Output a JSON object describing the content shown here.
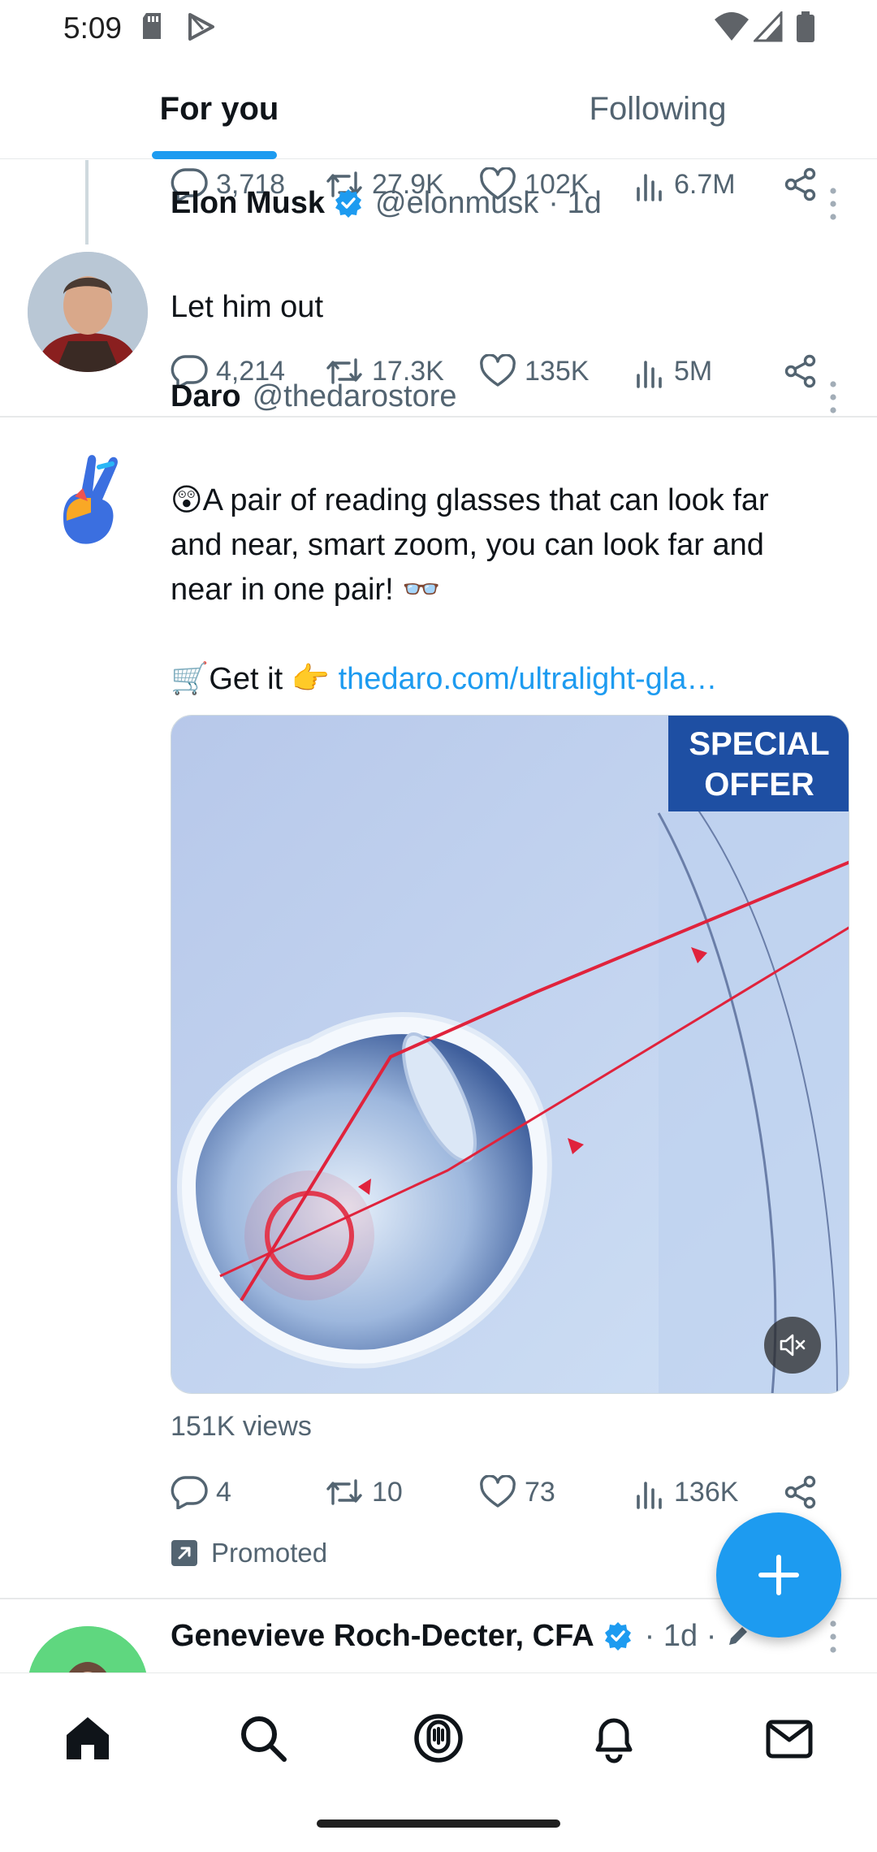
{
  "status_bar": {
    "time": "5:09"
  },
  "tabs": [
    {
      "label": "For you",
      "active": true
    },
    {
      "label": "Following",
      "active": false
    }
  ],
  "prev_tweet_actions": {
    "replies": "3,718",
    "retweets": "27.9K",
    "likes": "102K",
    "views": "6.7M"
  },
  "tweet1": {
    "name": "Elon Musk",
    "handle": "@elonmusk",
    "time": "· 1d",
    "text": "Let him out",
    "actions": {
      "replies": "4,214",
      "retweets": "17.3K",
      "likes": "135K",
      "views": "5M"
    }
  },
  "tweet2": {
    "name": "Daro",
    "handle": "@thedarostore",
    "text_line1": "😲A pair of reading glasses that can look far",
    "text_line2": "and near, smart zoom, you can look far and",
    "text_line3": "near in one pair! 👓",
    "cta_prefix": "🛒Get it 👉 ",
    "cta_link": "thedaro.com/ultralight-gla…",
    "media_badge_line1": "SPECIAL",
    "media_badge_line2": "OFFER",
    "views": "151K views",
    "actions": {
      "replies": "4",
      "retweets": "10",
      "likes": "73",
      "views": "136K"
    },
    "promoted": "Promoted"
  },
  "tweet3": {
    "name": "Genevieve Roch-Decter, CFA",
    "time": "· 1d ·"
  },
  "colors": {
    "accent": "#1d9bf0",
    "text": "#0f1419",
    "secondary": "#536471"
  },
  "bottom_nav": [
    "home-icon",
    "search-icon",
    "spaces-icon",
    "notifications-icon",
    "messages-icon"
  ]
}
